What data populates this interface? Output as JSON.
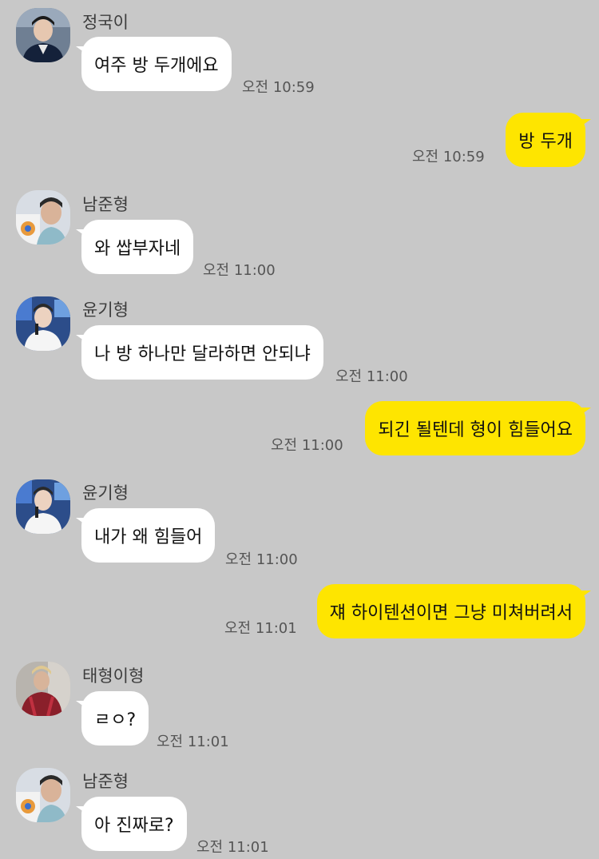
{
  "messages": [
    {
      "sender": "정국이",
      "text": "여주 방 두개에요",
      "time": "오전 10:59",
      "direction": "in"
    },
    {
      "text": "방 두개",
      "time": "오전 10:59",
      "direction": "out"
    },
    {
      "sender": "남준형",
      "text": "와 쌉부자네",
      "time": "오전 11:00",
      "direction": "in"
    },
    {
      "sender": "윤기형",
      "text": "나 방 하나만 달라하면 안되냐",
      "time": "오전 11:00",
      "direction": "in"
    },
    {
      "text": "되긴 될텐데 형이 힘들어요",
      "time": "오전 11:00",
      "direction": "out"
    },
    {
      "sender": "윤기형",
      "text": "내가 왜 힘들어",
      "time": "오전 11:00",
      "direction": "in"
    },
    {
      "text": "쟤 하이텐션이면 그냥 미쳐버려서",
      "time": "오전 11:01",
      "direction": "out"
    },
    {
      "sender": "태형이형",
      "text": "ㄹㅇ?",
      "time": "오전 11:01",
      "direction": "in"
    },
    {
      "sender": "남준형",
      "text": "아 진짜로?",
      "time": "오전 11:01",
      "direction": "in"
    }
  ],
  "colors": {
    "background": "#c8c8c8",
    "incoming_bubble": "#ffffff",
    "outgoing_bubble": "#fee500",
    "timestamp": "#555555",
    "sender_name": "#3c3c3c"
  }
}
